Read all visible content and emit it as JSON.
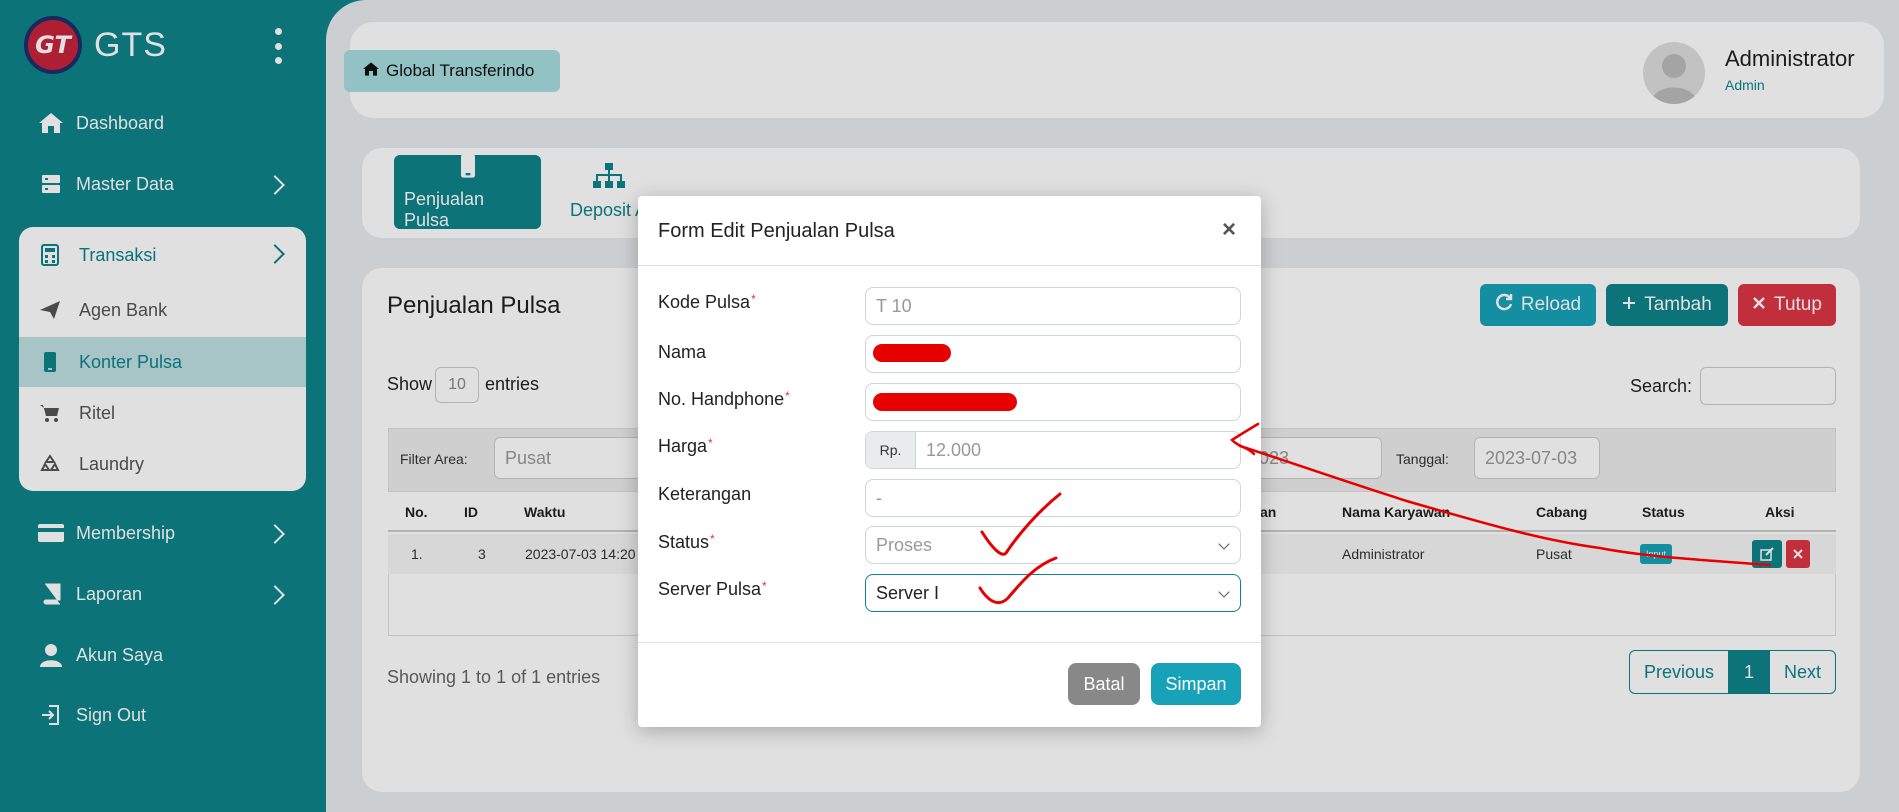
{
  "brand": {
    "name": "GTS",
    "logo_text": "GT"
  },
  "sidebar": {
    "items": [
      {
        "label": "Dashboard"
      },
      {
        "label": "Master Data"
      },
      {
        "label": "Transaksi"
      },
      {
        "label": "Agen Bank"
      },
      {
        "label": "Konter Pulsa"
      },
      {
        "label": "Ritel"
      },
      {
        "label": "Laundry"
      },
      {
        "label": "Membership"
      },
      {
        "label": "Laporan"
      },
      {
        "label": "Akun Saya"
      },
      {
        "label": "Sign Out"
      }
    ]
  },
  "header": {
    "breadcrumb": "Global Transferindo",
    "user_name": "Administrator",
    "user_role": "Admin"
  },
  "tabs": [
    {
      "label": "Penjualan Pulsa"
    },
    {
      "label": "Deposit A"
    }
  ],
  "card": {
    "title": "Penjualan Pulsa",
    "buttons": {
      "reload": "Reload",
      "tambah": "Tambah",
      "tutup": "Tutup"
    },
    "show_label": "Show",
    "show_value": "10",
    "entries_label": "entries",
    "search_label": "Search:",
    "filter": {
      "area_label": "Filter Area:",
      "area_value": "Pusat",
      "year_value": "2023",
      "date_label": "Tanggal:",
      "date_value": "2023-07-03"
    },
    "columns": [
      "No.",
      "ID",
      "Waktu",
      "an",
      "Nama Karyawan",
      "Cabang",
      "Status",
      "Aksi"
    ],
    "rows": [
      {
        "no": "1.",
        "id": "3",
        "waktu": "2023-07-03 14:20",
        "karyawan": "Administrator",
        "cabang": "Pusat",
        "status": "Input"
      }
    ],
    "showing": "Showing 1 to 1 of 1 entries",
    "pager": {
      "prev": "Previous",
      "page": "1",
      "next": "Next"
    }
  },
  "modal": {
    "title": "Form Edit Penjualan Pulsa",
    "close": "×",
    "fields": {
      "kode_label": "Kode Pulsa",
      "kode_value": "T 10",
      "nama_label": "Nama",
      "hp_label": "No. Handphone",
      "harga_label": "Harga",
      "harga_prefix": "Rp.",
      "harga_value": "12.000",
      "ket_label": "Keterangan",
      "ket_value": "-",
      "status_label": "Status",
      "status_value": "Proses",
      "server_label": "Server Pulsa",
      "server_value": "Server I"
    },
    "buttons": {
      "batal": "Batal",
      "simpan": "Simpan"
    }
  },
  "colors": {
    "primary": "#0e8389",
    "info": "#17a2b8",
    "danger": "#dc3545",
    "annotation": "#e60000"
  }
}
